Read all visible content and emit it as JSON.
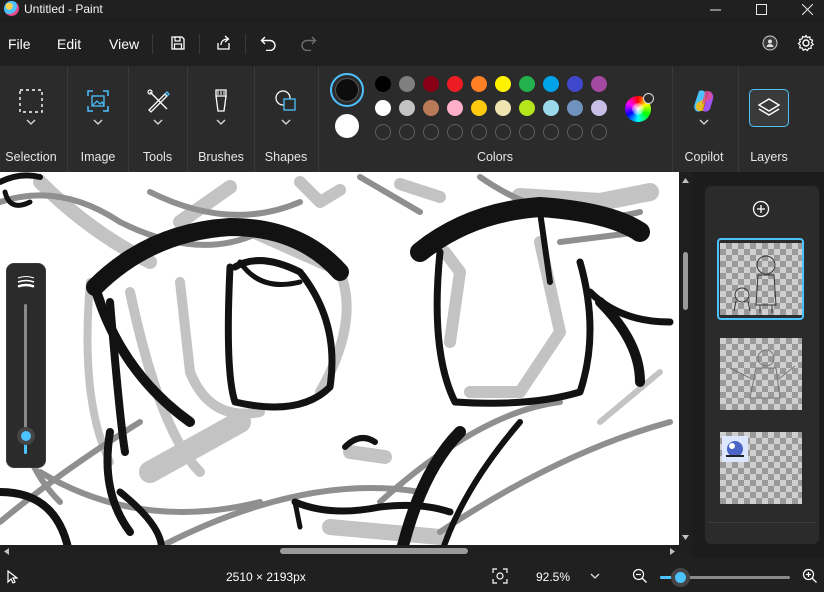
{
  "titlebar": {
    "title": "Untitled - Paint",
    "minimize_icon": "minimize-icon",
    "maximize_icon": "maximize-icon",
    "close_icon": "close-icon"
  },
  "menu": {
    "file": "File",
    "edit": "Edit",
    "view": "View"
  },
  "ribbon": {
    "groups": [
      {
        "label": "Selection",
        "icon": "selection-rectangle-icon"
      },
      {
        "label": "Image",
        "icon": "image-icon"
      },
      {
        "label": "Tools",
        "icon": "tools-icon"
      },
      {
        "label": "Brushes",
        "icon": "brush-icon"
      },
      {
        "label": "Shapes",
        "icon": "shapes-icon"
      },
      {
        "label": "Colors",
        "icon": "palette-icon"
      },
      {
        "label": "Copilot",
        "icon": "copilot-icon"
      },
      {
        "label": "Layers",
        "icon": "layers-icon"
      }
    ],
    "primary_color": "#0d0d0d",
    "secondary_color": "#ffffff",
    "palette_row1": [
      "#000000",
      "#7f7f7f",
      "#880015",
      "#ed1c24",
      "#ff7f27",
      "#fff200",
      "#22b14c",
      "#00a2e8",
      "#3f48cc",
      "#a349a4"
    ],
    "palette_row2": [
      "#ffffff",
      "#c3c3c3",
      "#b97a57",
      "#ffaec9",
      "#ffc90e",
      "#efe4b0",
      "#b5e61d",
      "#99d9ea",
      "#7092be",
      "#c8bfe7"
    ],
    "accent": "#4cc2ff"
  },
  "brush_size": {
    "level": 0.12
  },
  "layers": {
    "count": 3,
    "selected_index": 0
  },
  "status": {
    "canvas_size": "2510 × 2193px",
    "zoom": "92.5%",
    "zoom_level": 0.16
  }
}
